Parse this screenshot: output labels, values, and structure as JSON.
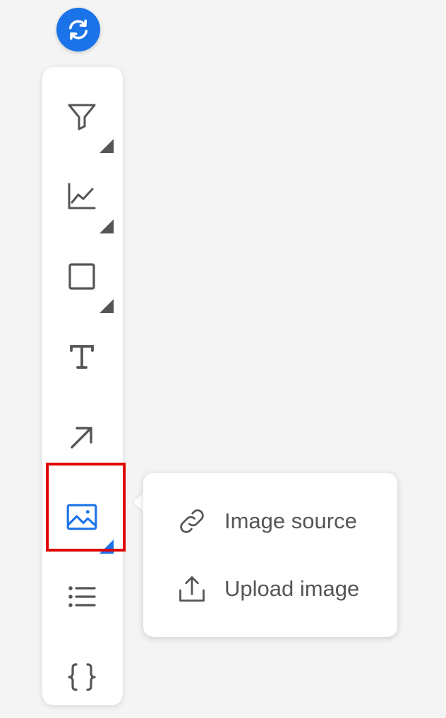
{
  "refresh": {
    "icon": "refresh-icon",
    "color": "#1a73e8"
  },
  "toolbar": {
    "tools": [
      {
        "icon": "filter-icon",
        "has_submenu": true
      },
      {
        "icon": "line-chart-icon",
        "has_submenu": true
      },
      {
        "icon": "rectangle-icon",
        "has_submenu": true
      },
      {
        "icon": "text-icon",
        "has_submenu": false
      },
      {
        "icon": "arrow-icon",
        "has_submenu": false
      },
      {
        "icon": "image-icon",
        "has_submenu": true,
        "selected": true
      },
      {
        "icon": "list-icon",
        "has_submenu": false
      },
      {
        "icon": "braces-icon",
        "has_submenu": false
      }
    ],
    "accent_color": "#1a73e8",
    "highlight_color": "#e00000"
  },
  "image_menu": {
    "items": [
      {
        "label": "Image source",
        "icon": "link-icon"
      },
      {
        "label": "Upload image",
        "icon": "upload-icon"
      }
    ]
  }
}
